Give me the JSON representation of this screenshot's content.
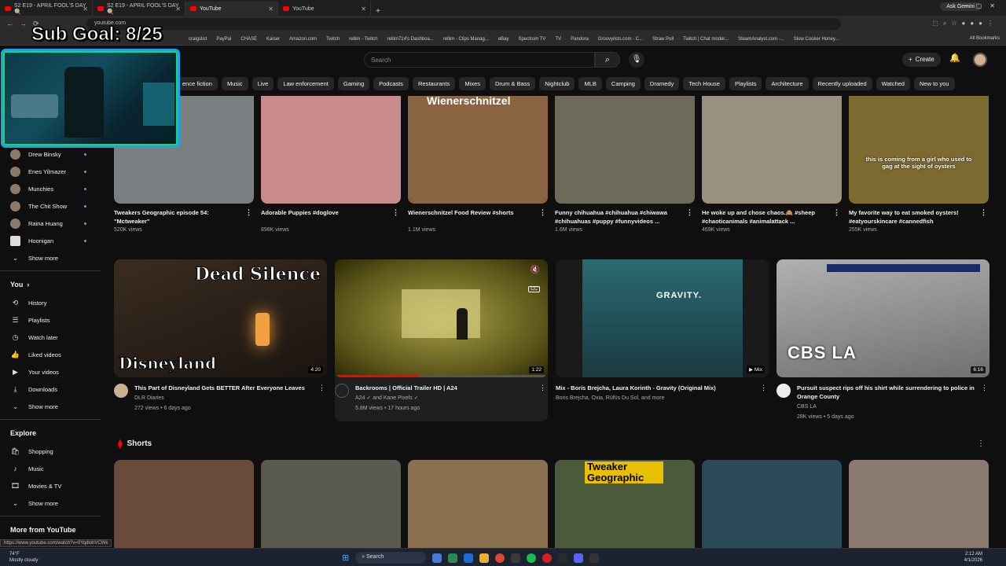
{
  "browser": {
    "tabs": [
      {
        "label": "S2 E19 - APRIL FOOL'S DAY 🍭"
      },
      {
        "label": "S2 E19 - APRIL FOOL'S DAY 🍭"
      },
      {
        "label": "YouTube"
      },
      {
        "label": "YouTube"
      }
    ],
    "ask_gemini": "Ask Gemini",
    "url": "youtube.com",
    "bookmarks": [
      "craigslist",
      "PayPal",
      "CHASE",
      "Kaiser",
      "Amazon.com",
      "Twitch",
      "rellim - Twitch",
      "rellim714's Dashboa...",
      "rellim - Clips Manag...",
      "eBay",
      "Spectrum TV",
      "TV",
      "Pandora",
      "Groovylists.com - C...",
      "Straw Poll",
      "Twitch | Chat moder...",
      "SteamAnalyst.com -...",
      "Slow Cooker Honey..."
    ],
    "all_bookmarks": "All Bookmarks"
  },
  "overlay": {
    "sub_goal": "Sub Goal: 8/25"
  },
  "youtube": {
    "search_placeholder": "Search",
    "create_label": "Create",
    "chips": [
      "ence fiction",
      "Music",
      "Live",
      "Law enforcement",
      "Gaming",
      "Podcasts",
      "Restaurants",
      "Mixes",
      "Drum & Bass",
      "Nightclub",
      "MLB",
      "Camping",
      "Dramedy",
      "Tech House",
      "Playlists",
      "Architecture",
      "Recently uploaded",
      "Watched",
      "New to you"
    ]
  },
  "sidebar": {
    "subscriptions": [
      {
        "label": "Drew Binsky"
      },
      {
        "label": "Enes Yilmazer"
      },
      {
        "label": "Munchies"
      },
      {
        "label": "The Chit Show"
      },
      {
        "label": "Raina Huang"
      },
      {
        "label": "Hoonigan"
      }
    ],
    "show_more_1": "Show more",
    "you_header": "You",
    "you_items": [
      {
        "label": "History",
        "icon": "history-icon",
        "glyph": "⟲"
      },
      {
        "label": "Playlists",
        "icon": "playlists-icon",
        "glyph": "☰"
      },
      {
        "label": "Watch later",
        "icon": "clock-icon",
        "glyph": "◷"
      },
      {
        "label": "Liked videos",
        "icon": "thumbs-up-icon",
        "glyph": "👍"
      },
      {
        "label": "Your videos",
        "icon": "your-videos-icon",
        "glyph": "▶"
      },
      {
        "label": "Downloads",
        "icon": "download-icon",
        "glyph": "⤓"
      }
    ],
    "show_more_2": "Show more",
    "explore_header": "Explore",
    "explore_items": [
      {
        "label": "Shopping",
        "icon": "shopping-bag-icon",
        "glyph": "🛍"
      },
      {
        "label": "Music",
        "icon": "music-note-icon",
        "glyph": "♪"
      },
      {
        "label": "Movies & TV",
        "icon": "movies-icon",
        "glyph": "🎞"
      }
    ],
    "show_more_3": "Show more",
    "more_from": "More from YouTube"
  },
  "row1": [
    {
      "title": "Tweakers Geographic episode 54: \"Mctweaker\"",
      "meta": "520K views",
      "bg": "#7a7f82"
    },
    {
      "title": "Adorable Puppies #doglove",
      "meta": "898K views",
      "bg": "#c98a8a"
    },
    {
      "title": "Wienerschnitzel Food Review #shorts",
      "meta": "1.1M views",
      "bg": "#8a6440",
      "overlay": "Wienerschnitzel"
    },
    {
      "title": "Funny chihuahua #chihuahua #chiwawa #chihuahuas #puppy #funnyvideos ...",
      "meta": "1.6M views",
      "bg": "#6d6a5a"
    },
    {
      "title": "He woke up and chose chaos.🙈 #sheep #chaoticanimals #animalattack ...",
      "meta": "469K views",
      "bg": "#9a9080"
    },
    {
      "title": "My favorite way to eat smoked oysters! #eatyourskincare #cannedfish",
      "meta": "255K views",
      "bg": "#7d6a30",
      "overlay": "this is coming from a girl who used to gag at the sight of oysters"
    }
  ],
  "row2": [
    {
      "title": "This Part of Disneyland Gets BETTER After Everyone Leaves",
      "channel": "DLR Diaries",
      "meta": "272 views • 6 days ago",
      "duration": "4:20",
      "bg": "#2a2118",
      "overlay_top": "Dead Silence",
      "overlay_bottom": "Disneyland"
    },
    {
      "title": "Backrooms | Official Trailer HD | A24",
      "channel": "A24 ✓ and Kane Pixels ✓",
      "meta": "5.8M views • 17 hours ago",
      "duration": "1:22",
      "bg": "#6b6420"
    },
    {
      "title": "Mix - Boris Brejcha, Laura Korinth - Gravity (Original Mix)",
      "channel": "Boris Brejcha, Oxia, Rüfüs Du Sol, and more",
      "meta": "",
      "duration": "Mix",
      "bg": "#3a2c2c",
      "overlay": "GRAVITY."
    },
    {
      "title": "Pursuit suspect rips off his shirt while surrendering to police in Orange County",
      "channel": "CBS LA",
      "meta": "28K views • 5 days ago",
      "duration": "6:16",
      "bg": "#8a8a8a",
      "overlay": "CBS LA"
    }
  ],
  "shorts": {
    "title": "Shorts",
    "items": [
      {
        "bg": "#6a4a3a"
      },
      {
        "bg": "#5a5a50"
      },
      {
        "bg": "#8a7050"
      },
      {
        "bg": "#4a5a3a",
        "overlay": "Tweaker Geographic"
      },
      {
        "bg": "#2a4a5a"
      },
      {
        "bg": "#8a7a70"
      }
    ]
  },
  "statusbar": {
    "url": "https://www.youtube.com/watch?v=0YqdlohVCWk"
  },
  "taskbar": {
    "temp": "74°F",
    "weather": "Mostly cloudy",
    "search": "Search",
    "time": "2:12 AM",
    "date": "4/1/2026"
  }
}
